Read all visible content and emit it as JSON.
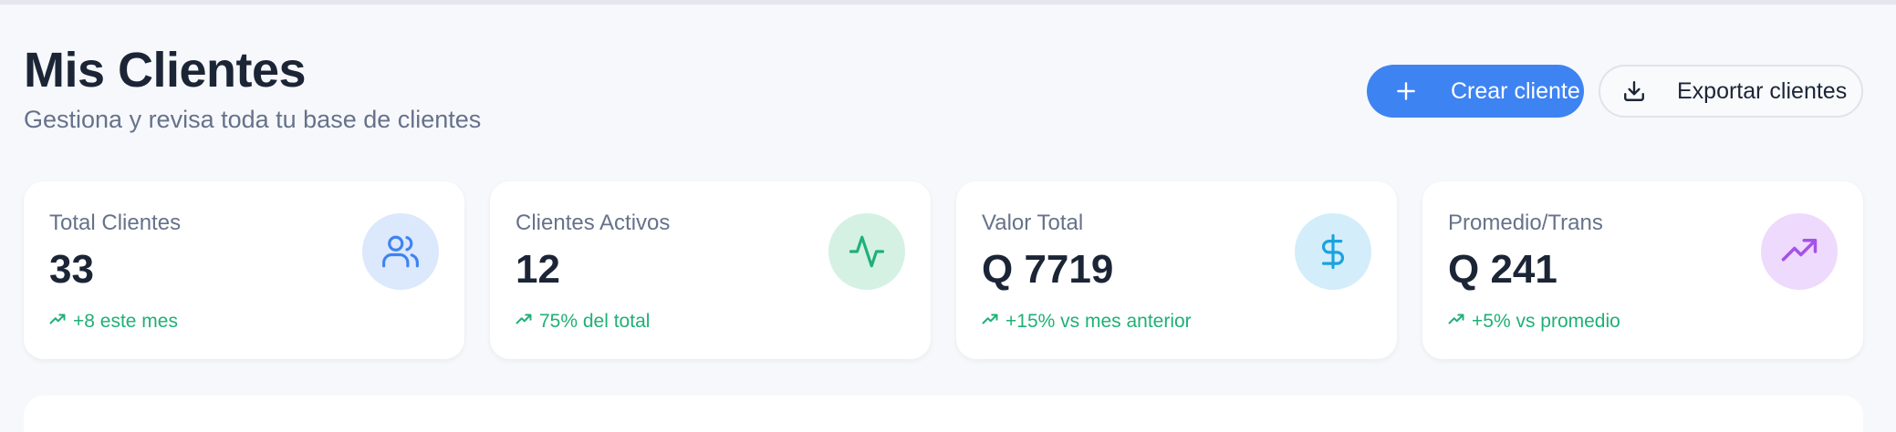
{
  "header": {
    "title": "Mis Clientes",
    "subtitle": "Gestiona y revisa toda tu base de clientes"
  },
  "actions": {
    "create_label": "Crear cliente",
    "export_label": "Exportar clientes"
  },
  "stats": [
    {
      "label": "Total Clientes",
      "value": "33",
      "trend": "+8 este mes",
      "icon": "users-icon",
      "icon_color": "#3e83f2",
      "icon_bg": "#dce8fc"
    },
    {
      "label": "Clientes Activos",
      "value": "12",
      "trend": "75% del total",
      "icon": "activity-icon",
      "icon_color": "#1fb077",
      "icon_bg": "#d4f1e4"
    },
    {
      "label": "Valor Total",
      "value": "Q 7719",
      "trend": "+15% vs mes anterior",
      "icon": "dollar-icon",
      "icon_color": "#1aa3de",
      "icon_bg": "#d3edfa"
    },
    {
      "label": "Promedio/Trans",
      "value": "Q 241",
      "trend": "+5% vs promedio",
      "icon": "trending-up-icon",
      "icon_color": "#a552e8",
      "icon_bg": "#eedafc"
    }
  ],
  "colors": {
    "accent": "#3e83f2",
    "positive": "#1fb077"
  }
}
